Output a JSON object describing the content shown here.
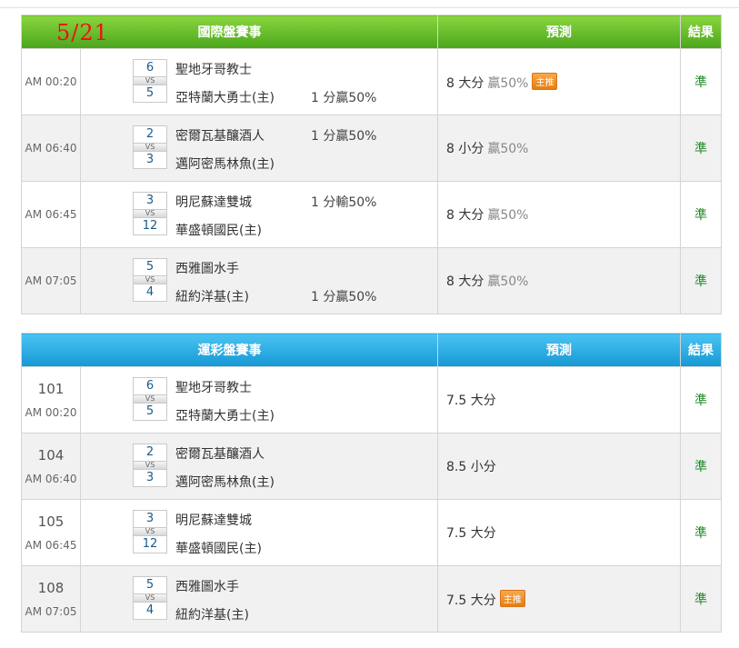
{
  "date": "5/21",
  "panels": [
    {
      "title": "國際盤賽事",
      "prediction_header": "預測",
      "result_header": "結果",
      "rows": [
        {
          "num": "",
          "time": "AM 00:20",
          "score1": "6",
          "vs": "VS",
          "score2": "5",
          "team1": "聖地牙哥教士",
          "team2": "亞特蘭大勇士(主)",
          "odds1": "",
          "odds2": "1 分贏50%",
          "pred": "8 大分",
          "win": "贏50%",
          "badge": "主推",
          "result": "準"
        },
        {
          "num": "",
          "time": "AM 06:40",
          "score1": "2",
          "vs": "VS",
          "score2": "3",
          "team1": "密爾瓦基釀酒人",
          "team2": "邁阿密馬林魚(主)",
          "odds1": "1 分贏50%",
          "odds2": "",
          "pred": "8 小分",
          "win": "贏50%",
          "badge": "",
          "result": "準"
        },
        {
          "num": "",
          "time": "AM 06:45",
          "score1": "3",
          "vs": "VS",
          "score2": "12",
          "team1": "明尼蘇達雙城",
          "team2": "華盛頓國民(主)",
          "odds1": "1 分輸50%",
          "odds2": "",
          "pred": "8 大分",
          "win": "贏50%",
          "badge": "",
          "result": "準"
        },
        {
          "num": "",
          "time": "AM 07:05",
          "score1": "5",
          "vs": "VS",
          "score2": "4",
          "team1": "西雅圖水手",
          "team2": "紐約洋基(主)",
          "odds1": "",
          "odds2": "1 分贏50%",
          "pred": "8 大分",
          "win": "贏50%",
          "badge": "",
          "result": "準"
        }
      ]
    },
    {
      "title": "運彩盤賽事",
      "prediction_header": "預測",
      "result_header": "結果",
      "rows": [
        {
          "num": "101",
          "time": "AM 00:20",
          "score1": "6",
          "vs": "VS",
          "score2": "5",
          "team1": "聖地牙哥教士",
          "team2": "亞特蘭大勇士(主)",
          "odds1": "",
          "odds2": "",
          "pred": "7.5 大分",
          "win": "",
          "badge": "",
          "result": "準"
        },
        {
          "num": "104",
          "time": "AM 06:40",
          "score1": "2",
          "vs": "VS",
          "score2": "3",
          "team1": "密爾瓦基釀酒人",
          "team2": "邁阿密馬林魚(主)",
          "odds1": "",
          "odds2": "",
          "pred": "8.5 小分",
          "win": "",
          "badge": "",
          "result": "準"
        },
        {
          "num": "105",
          "time": "AM 06:45",
          "score1": "3",
          "vs": "VS",
          "score2": "12",
          "team1": "明尼蘇達雙城",
          "team2": "華盛頓國民(主)",
          "odds1": "",
          "odds2": "",
          "pred": "7.5 大分",
          "win": "",
          "badge": "",
          "result": "準"
        },
        {
          "num": "108",
          "time": "AM 07:05",
          "score1": "5",
          "vs": "VS",
          "score2": "4",
          "team1": "西雅圖水手",
          "team2": "紐約洋基(主)",
          "odds1": "",
          "odds2": "",
          "pred": "7.5 大分",
          "win": "",
          "badge": "主推",
          "result": "準"
        }
      ]
    }
  ]
}
